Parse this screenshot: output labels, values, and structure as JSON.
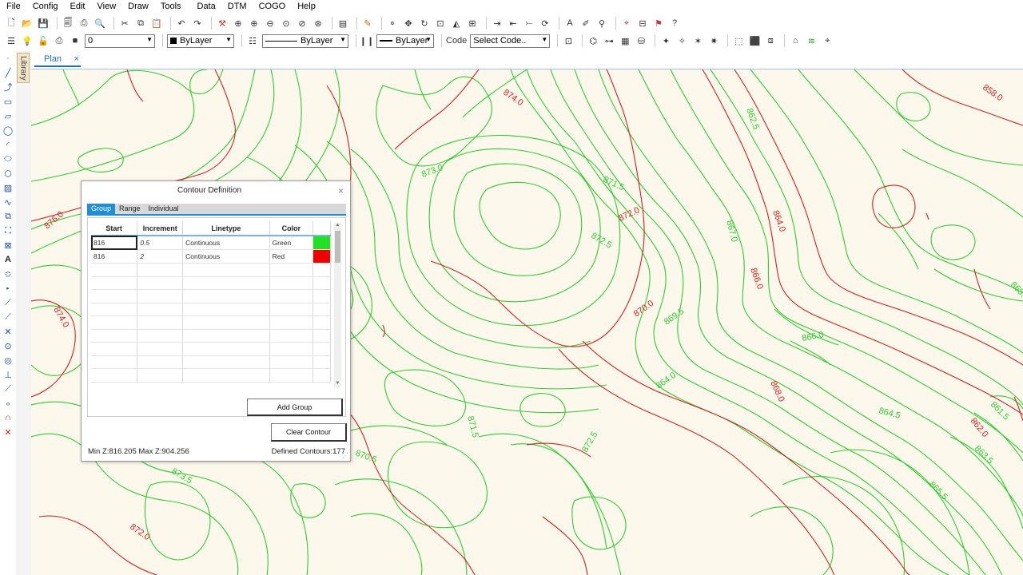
{
  "menu": [
    "File",
    "Config",
    "Edit",
    "View",
    "Draw",
    "Tools",
    "Data",
    "DTM",
    "COGO",
    "Help"
  ],
  "toolbar2": {
    "layer_value": "0",
    "color_value": "ByLayer",
    "linetype_value": "ByLayer",
    "lineweight_value": "ByLayer",
    "code_label": "Code",
    "code_placeholder": "Select Code.."
  },
  "left_pane": {
    "library_tab": "Library"
  },
  "doc_tab": {
    "label": "Plan",
    "close": "×"
  },
  "dialog": {
    "title": "Contour Definition",
    "close": "×",
    "tabs": [
      "Group",
      "Range",
      "Individual"
    ],
    "active_tab": "Group",
    "columns": [
      "Start",
      "Increment",
      "Linetype",
      "Color"
    ],
    "rows": [
      {
        "start": "816",
        "increment": "0.5",
        "linetype": "Continuous",
        "color": "Green",
        "swatch": "#22e022"
      },
      {
        "start": "816",
        "increment": "2",
        "linetype": "Continuous",
        "color": "Red",
        "swatch": "#ee0000"
      }
    ],
    "add_group": "Add Group",
    "clear_contour": "Clear Contour",
    "min_max": "Min Z:816.205 Max Z:904.256",
    "defined_contours": "Defined Contours:177"
  },
  "contour_labels": [
    "874.0",
    "858.0",
    "876.0",
    "873.0",
    "871.5",
    "872.0",
    "872.5",
    "870.0",
    "869.5",
    "867.0",
    "866.0",
    "864.0",
    "862.5",
    "868.5",
    "874.0",
    "870.5",
    "871.5",
    "873.5",
    "872.5",
    "872.0",
    "864.0",
    "866.0",
    "868.0",
    "864.5",
    "862.0",
    "863.5",
    "865.5",
    "861.5"
  ],
  "colors": {
    "minor": "#2ecc2e",
    "major": "#d41f1f",
    "canvas": "#fdf8ec",
    "accent": "#1e8fd6"
  }
}
